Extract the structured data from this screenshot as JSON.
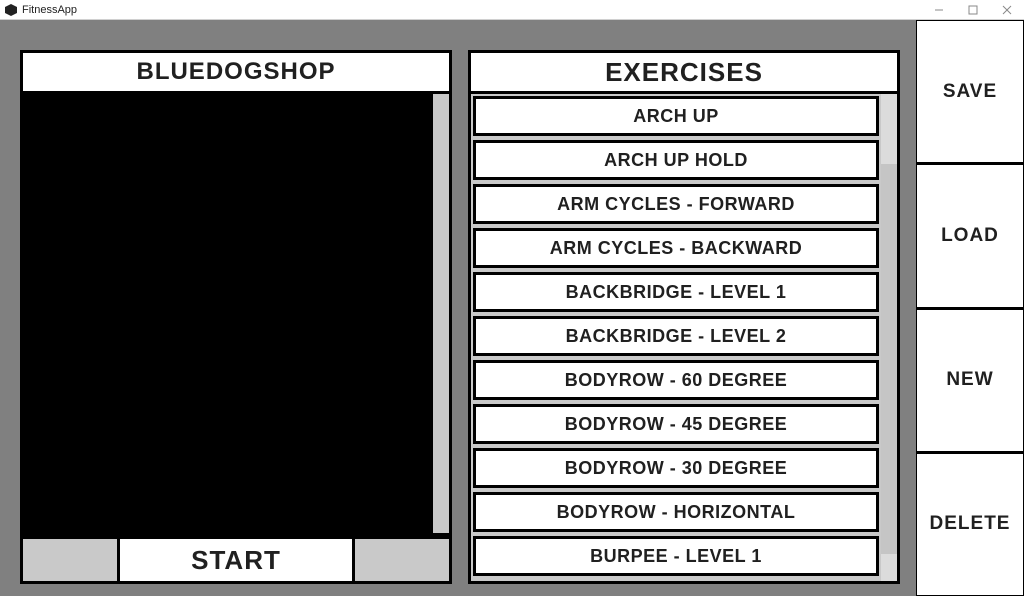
{
  "window": {
    "title": "FitnessApp"
  },
  "left_panel": {
    "header": "BlueDogShop",
    "start_label": "Start"
  },
  "right_panel": {
    "header": "Exercises",
    "items": [
      "Arch Up",
      "Arch Up Hold",
      "Arm Cycles - Forward",
      "Arm Cycles - Backward",
      "Backbridge - Level 1",
      "Backbridge - Level 2",
      "Bodyrow - 60 degree",
      "Bodyrow - 45 degree",
      "Bodyrow - 30 degree",
      "Bodyrow - Horizontal",
      "Burpee - Level 1"
    ]
  },
  "sidebar": {
    "save": "Save",
    "load": "Load",
    "new": "New",
    "delete": "Delete"
  }
}
